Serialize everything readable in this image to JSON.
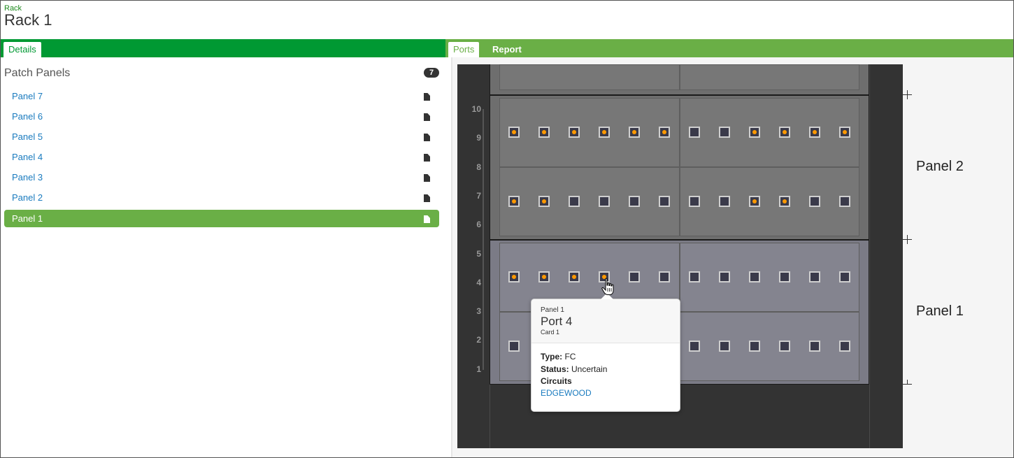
{
  "header": {
    "breadcrumb": "Rack",
    "title": "Rack 1"
  },
  "left": {
    "tab": "Details",
    "patch_panels": {
      "title": "Patch Panels",
      "count": "7",
      "items": [
        {
          "label": "Panel 7",
          "active": false
        },
        {
          "label": "Panel 6",
          "active": false
        },
        {
          "label": "Panel 5",
          "active": false
        },
        {
          "label": "Panel 4",
          "active": false
        },
        {
          "label": "Panel 3",
          "active": false
        },
        {
          "label": "Panel 2",
          "active": false
        },
        {
          "label": "Panel 1",
          "active": true
        }
      ]
    }
  },
  "right": {
    "tabs": [
      {
        "label": "Ports",
        "active": true
      },
      {
        "label": "Report",
        "active": false
      }
    ]
  },
  "rack": {
    "ru_numbers": [
      "10",
      "9",
      "8",
      "7",
      "6",
      "5",
      "4",
      "3",
      "2",
      "1"
    ],
    "panels": [
      {
        "label": "Panel 2",
        "rows": [
          [
            true,
            true,
            true,
            true,
            true,
            true,
            false,
            false,
            true,
            true,
            true,
            true
          ],
          [
            true,
            true,
            false,
            false,
            false,
            false,
            false,
            false,
            true,
            true,
            false,
            false
          ]
        ]
      },
      {
        "label": "Panel 1",
        "rows": [
          [
            true,
            true,
            true,
            true,
            false,
            false,
            false,
            false,
            false,
            false,
            false,
            false
          ],
          [
            false,
            false,
            false,
            false,
            false,
            false,
            false,
            false,
            false,
            false,
            false,
            false
          ]
        ]
      }
    ],
    "colors": {
      "connected_dot": "#ff9900",
      "panel2_bg": "#777777",
      "panel1_bg": "#84848f"
    }
  },
  "tooltip": {
    "panel": "Panel 1",
    "port": "Port 4",
    "card": "Card 1",
    "type_label": "Type:",
    "type_value": "FC",
    "status_label": "Status:",
    "status_value": "Uncertain",
    "circuits_label": "Circuits",
    "circuit": "EDGEWOOD"
  }
}
